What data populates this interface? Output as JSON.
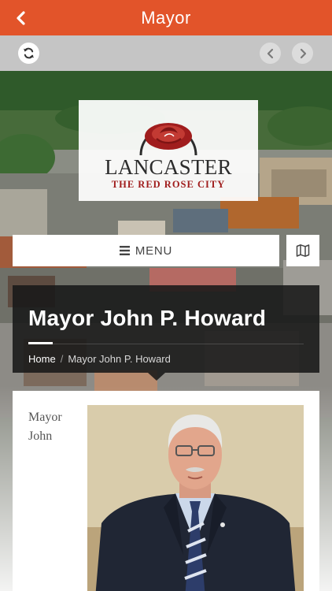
{
  "header": {
    "title": "Mayor",
    "back_icon": "chevron-left-icon"
  },
  "toolbar": {
    "refresh_icon": "refresh-icon",
    "prev_icon": "chevron-left-icon",
    "next_icon": "chevron-right-icon"
  },
  "logo": {
    "name": "LANCASTER",
    "tagline": "THE RED ROSE CITY",
    "emblem": "red-rose-icon"
  },
  "nav": {
    "menu_label": "MENU",
    "menu_icon": "hamburger-icon",
    "map_icon": "map-icon"
  },
  "page": {
    "title": "Mayor John P. Howard",
    "breadcrumb": {
      "home": "Home",
      "separator": "/",
      "current": "Mayor John P. Howard"
    }
  },
  "content": {
    "text_line1": "Mayor",
    "text_line2": "John",
    "photo_subject": "portrait-photo"
  },
  "colors": {
    "accent": "#e2542a",
    "toolbar": "#c5c5c5",
    "panel": "#181818",
    "rose": "#a01d1d"
  }
}
